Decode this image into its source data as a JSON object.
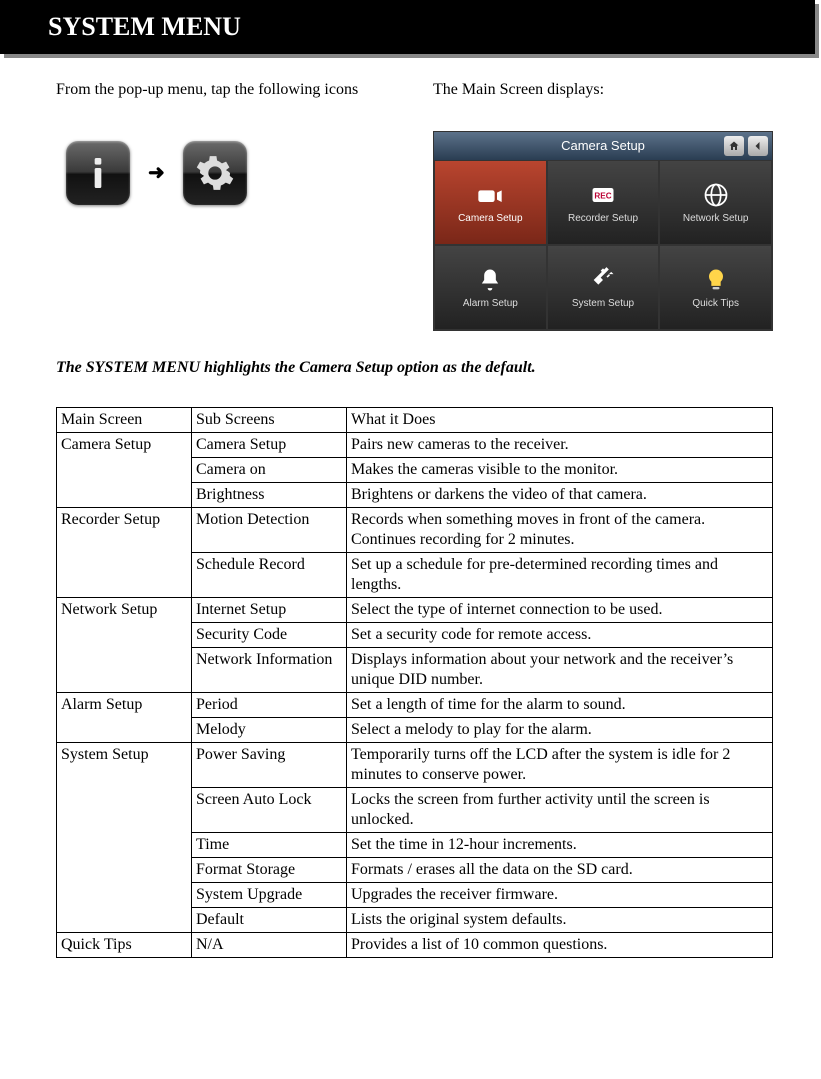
{
  "header": {
    "title": "SYSTEM MENU"
  },
  "intro": {
    "left": "From the pop-up menu, tap the following icons",
    "right": "The Main Screen displays:",
    "arrow": "➜"
  },
  "screenshot": {
    "title": "Camera Setup",
    "tiles": [
      {
        "label": "Camera Setup",
        "icon": "camera"
      },
      {
        "label": "Recorder Setup",
        "icon": "rec"
      },
      {
        "label": "Network Setup",
        "icon": "globe"
      },
      {
        "label": "Alarm Setup",
        "icon": "bell"
      },
      {
        "label": "System Setup",
        "icon": "tools"
      },
      {
        "label": "Quick Tips",
        "icon": "bulb"
      }
    ]
  },
  "caption": "The SYSTEM MENU highlights the Camera Setup option as the default.",
  "table": {
    "headers": {
      "col1": "Main Screen",
      "col2": "Sub Screens",
      "col3": "What it Does"
    },
    "groups": [
      {
        "main": "Camera Setup",
        "rows": [
          {
            "sub": "Camera Setup",
            "desc": "Pairs new cameras to the receiver."
          },
          {
            "sub": "Camera on",
            "desc": "Makes the cameras visible to the monitor."
          },
          {
            "sub": "Brightness",
            "desc": "Brightens or darkens the video of that camera."
          }
        ]
      },
      {
        "main": "Recorder Setup",
        "rows": [
          {
            "sub": "Motion Detection",
            "desc": "Records when something moves in front of the camera. Continues recording for 2 minutes."
          },
          {
            "sub": "Schedule Record",
            "desc": "Set up a schedule for pre-determined recording times and lengths."
          }
        ]
      },
      {
        "main": "Network Setup",
        "rows": [
          {
            "sub": "Internet Setup",
            "desc": "Select the type of internet connection to be used."
          },
          {
            "sub": "Security Code",
            "desc": "Set a security code for remote access."
          },
          {
            "sub": "Network Information",
            "desc": "Displays information about your network and the receiver’s unique DID number."
          }
        ]
      },
      {
        "main": "Alarm Setup",
        "rows": [
          {
            "sub": "Period",
            "desc": "Set a length of time for the alarm to sound."
          },
          {
            "sub": "Melody",
            "desc": "Select a melody to play for the alarm."
          }
        ]
      },
      {
        "main": "System Setup",
        "rows": [
          {
            "sub": "Power Saving",
            "desc": "Temporarily turns off the LCD after the system is idle for 2 minutes to conserve power."
          },
          {
            "sub": "Screen Auto Lock",
            "desc": "Locks the screen from further activity until the screen is unlocked."
          },
          {
            "sub": "Time",
            "desc": "Set the time in 12-hour increments."
          },
          {
            "sub": "Format Storage",
            "desc": "Formats / erases all the data on the SD card."
          },
          {
            "sub": "System Upgrade",
            "desc": "Upgrades the receiver firmware."
          },
          {
            "sub": "Default",
            "desc": "Lists the original system defaults."
          }
        ]
      },
      {
        "main": "Quick Tips",
        "rows": [
          {
            "sub": "N/A",
            "desc": "Provides a list of 10 common questions."
          }
        ]
      }
    ]
  }
}
